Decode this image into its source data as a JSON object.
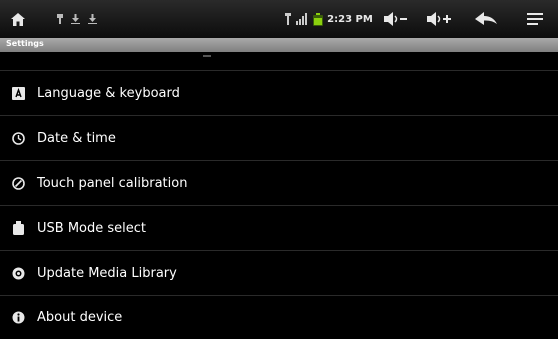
{
  "statusbar": {
    "home_icon": "home-icon",
    "notif_icons": [
      "usb-icon",
      "download-icon",
      "download-icon"
    ],
    "usb_icon": "usb-icon",
    "signal_icon": "signal-icon",
    "battery_icon": "battery-icon",
    "time": "2:23 PM",
    "vol_down_icon": "volume-down-icon",
    "vol_up_icon": "volume-up-icon",
    "back_icon": "back-icon",
    "menu_icon": "menu-icon"
  },
  "header": {
    "title": "Settings"
  },
  "settings": {
    "items": [
      {
        "label": "Language & keyboard",
        "icon": "keyboard-icon"
      },
      {
        "label": "Date & time",
        "icon": "clock-icon"
      },
      {
        "label": "Touch panel calibration",
        "icon": "calibration-icon"
      },
      {
        "label": "USB Mode select",
        "icon": "usb-mode-icon"
      },
      {
        "label": "Update Media Library",
        "icon": "media-library-icon"
      },
      {
        "label": "About device",
        "icon": "info-icon"
      }
    ]
  },
  "colors": {
    "background": "#000000",
    "titlebar": "#8f8f8f",
    "divider": "#2a2a2a"
  }
}
